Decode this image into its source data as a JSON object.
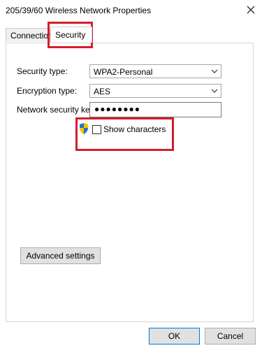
{
  "window": {
    "title": "205/39/60 Wireless Network Properties",
    "close_icon": "close-icon"
  },
  "tabs": [
    {
      "label": "Connection"
    },
    {
      "label": "Security",
      "selected": true
    }
  ],
  "security": {
    "security_type_label": "Security type:",
    "security_type_value": "WPA2-Personal",
    "encryption_type_label": "Encryption type:",
    "encryption_type_value": "AES",
    "network_key_label": "Network security key",
    "network_key_masked": "●●●●●●●●",
    "show_characters_label": "Show characters",
    "show_characters_checked": false,
    "advanced_settings_label": "Advanced settings"
  },
  "footer": {
    "ok_label": "OK",
    "cancel_label": "Cancel"
  },
  "annotations": {
    "highlight_color": "#d21f2a"
  }
}
